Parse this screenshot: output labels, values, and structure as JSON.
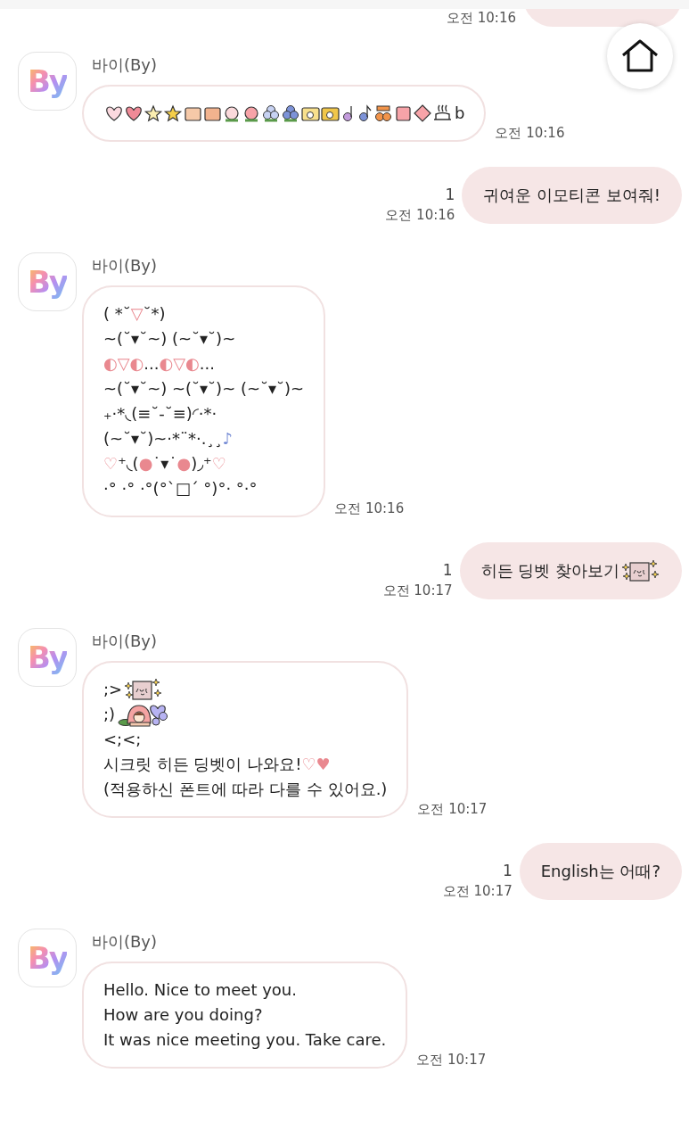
{
  "messages": [
    {
      "kind": "user",
      "time": "오전 10:16"
    },
    {
      "kind": "bot",
      "avatar": "By",
      "sender": "바이(By)",
      "time": "오전 10:16",
      "lines": [
        [
          {
            "kind": "sticker"
          },
          {
            "kind": "text",
            "text": "b"
          }
        ]
      ]
    },
    {
      "kind": "user",
      "read": "1",
      "time": "오전 10:16",
      "lines": [
        [
          {
            "kind": "text",
            "text": "귀여운 이모티콘 보여줘!"
          }
        ]
      ]
    },
    {
      "kind": "bot",
      "avatar": "By",
      "sender": "바이(By)",
      "time": "오전 10:16",
      "lines": [
        [
          {
            "kind": "text",
            "text": "( *˘"
          },
          {
            "kind": "accent",
            "text": "▽"
          },
          {
            "kind": "text",
            "text": "˘*)"
          }
        ],
        [
          {
            "kind": "text",
            "text": "~(˘▾˘~) (~˘▾˘)~"
          }
        ],
        [
          {
            "kind": "accent",
            "text": "◐▽◐"
          },
          {
            "kind": "text",
            "text": "..."
          },
          {
            "kind": "accent",
            "text": "◐▽◐"
          },
          {
            "kind": "text",
            "text": "..."
          }
        ],
        [
          {
            "kind": "text",
            "text": "~(˘▾˘~) ~(˘▾˘)~ (~˘▾˘)~"
          }
        ],
        [
          {
            "kind": "text",
            "text": "₊·*◟(≡˘-˘≡)◜·*·"
          }
        ],
        [
          {
            "kind": "text",
            "text": "(~˘▾˘)~·*¨*·.¸¸"
          },
          {
            "kind": "note",
            "text": "♪"
          }
        ],
        [
          {
            "kind": "accent",
            "text": "♡"
          },
          {
            "kind": "text",
            "text": "⁺◟("
          },
          {
            "kind": "accent",
            "text": "●"
          },
          {
            "kind": "text",
            "text": "˙▾˙"
          },
          {
            "kind": "accent",
            "text": "●"
          },
          {
            "kind": "text",
            "text": ")◞⁺"
          },
          {
            "kind": "accent",
            "text": "♡"
          }
        ],
        [
          {
            "kind": "text",
            "text": "·° ·° ·°(°`□´ °)°· °·°"
          }
        ]
      ]
    },
    {
      "kind": "user",
      "read": "1",
      "time": "오전 10:17",
      "lines": [
        [
          {
            "kind": "text",
            "text": "히든 딩벳 찾아보기 "
          },
          {
            "kind": "sticker"
          }
        ]
      ]
    },
    {
      "kind": "bot",
      "avatar": "By",
      "sender": "바이(By)",
      "time": "오전 10:17",
      "lines": [
        [
          {
            "kind": "text",
            "text": ";> "
          },
          {
            "kind": "sticker"
          }
        ],
        [
          {
            "kind": "text",
            "text": ";) "
          },
          {
            "kind": "sticker"
          }
        ],
        [
          {
            "kind": "text",
            "text": "<;<;"
          }
        ],
        [
          {
            "kind": "text",
            "text": "시크릿 히든 딩벳이 나와요! "
          },
          {
            "kind": "accent",
            "text": "♡♥"
          }
        ],
        [
          {
            "kind": "text",
            "text": "(적용하신 폰트에 따라 다를 수 있어요.)"
          }
        ]
      ]
    },
    {
      "kind": "user",
      "read": "1",
      "time": "오전 10:17",
      "lines": [
        [
          {
            "kind": "text",
            "text": "English는 어때?"
          }
        ]
      ]
    },
    {
      "kind": "bot",
      "avatar": "By",
      "sender": "바이(By)",
      "time": "오전 10:17",
      "lines": [
        [
          {
            "kind": "text",
            "text": "Hello. Nice to meet you."
          }
        ],
        [
          {
            "kind": "text",
            "text": "How are you doing?"
          }
        ],
        [
          {
            "kind": "text",
            "text": "It was nice meeting you. Take care."
          }
        ]
      ]
    }
  ]
}
